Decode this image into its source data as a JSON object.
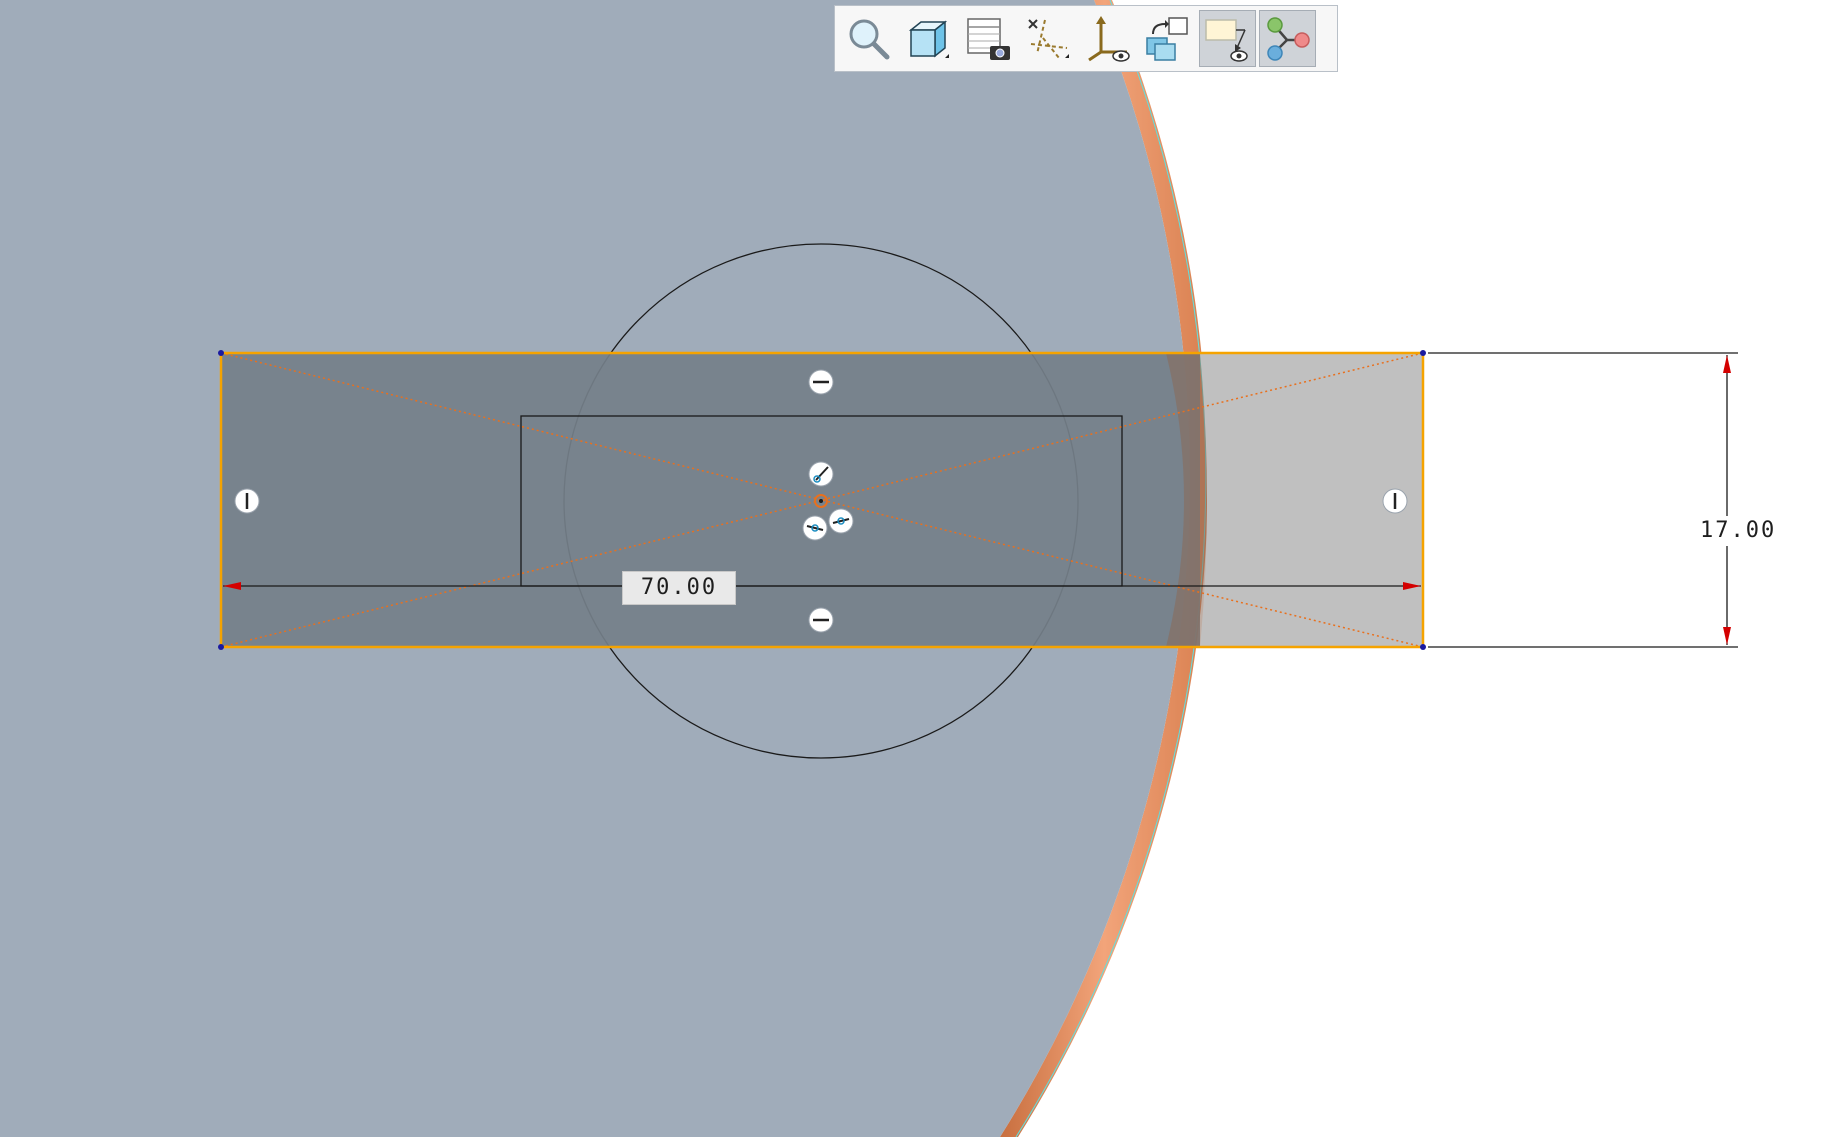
{
  "toolbar": {
    "items": [
      {
        "name": "zoom-to-fit",
        "icon": "magnifier-icon",
        "active": false
      },
      {
        "name": "display-style",
        "icon": "cube-icon",
        "active": false
      },
      {
        "name": "saved-views",
        "icon": "view-manager-camera-icon",
        "active": false
      },
      {
        "name": "datum-display",
        "icon": "datum-filters-icon",
        "active": false
      },
      {
        "name": "csys-display",
        "icon": "csys-eye-icon",
        "active": false
      },
      {
        "name": "repaint",
        "icon": "repaint-icon",
        "active": false
      },
      {
        "name": "sketch-view",
        "icon": "sketch-view-icon",
        "active": true
      },
      {
        "name": "sketcher-display",
        "icon": "constraint-display-icon",
        "active": true
      }
    ]
  },
  "dimensions": {
    "width_value": "70.00",
    "height_value": "17.00"
  },
  "colors": {
    "part_face": "#a0acba",
    "sketch_fill": "#747f89",
    "outside_fill": "#c0c0c0",
    "selection": "#f5a300",
    "edge": "#e58a5c",
    "dimension_arrow": "#d40000"
  }
}
